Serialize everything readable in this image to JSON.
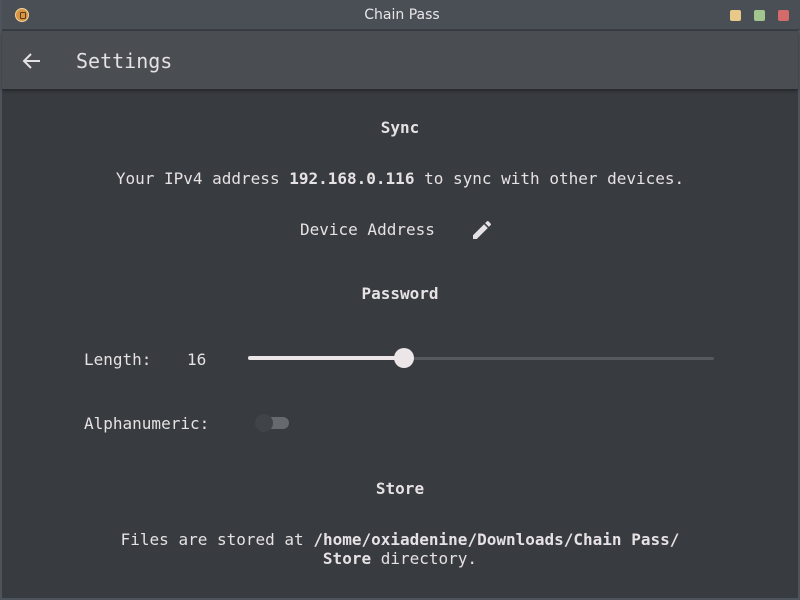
{
  "window": {
    "title": "Chain Pass",
    "buttons": {
      "minimize_color": "#e8c987",
      "maximize_color": "#a3c690",
      "close_color": "#d46a6a"
    }
  },
  "appbar": {
    "back_icon": "arrow-left-icon",
    "title": "Settings"
  },
  "sync": {
    "title": "Sync",
    "ip_prefix": "Your IPv4 address",
    "ip_address": "192.168.0.116",
    "ip_suffix": "to sync with other devices.",
    "device_address_label": "Device Address",
    "edit_icon": "pencil-icon"
  },
  "password": {
    "title": "Password",
    "length_label": "Length:",
    "length_value": "16",
    "length_slider_fraction": 0.335,
    "alphanumeric_label": "Alphanumeric:",
    "alphanumeric_enabled": false
  },
  "store": {
    "title": "Store",
    "prefix": "Files are stored at",
    "path_line1": "/home/oxiadenine/Downloads/Chain Pass/",
    "path_line2": "Store",
    "suffix": "directory."
  }
}
